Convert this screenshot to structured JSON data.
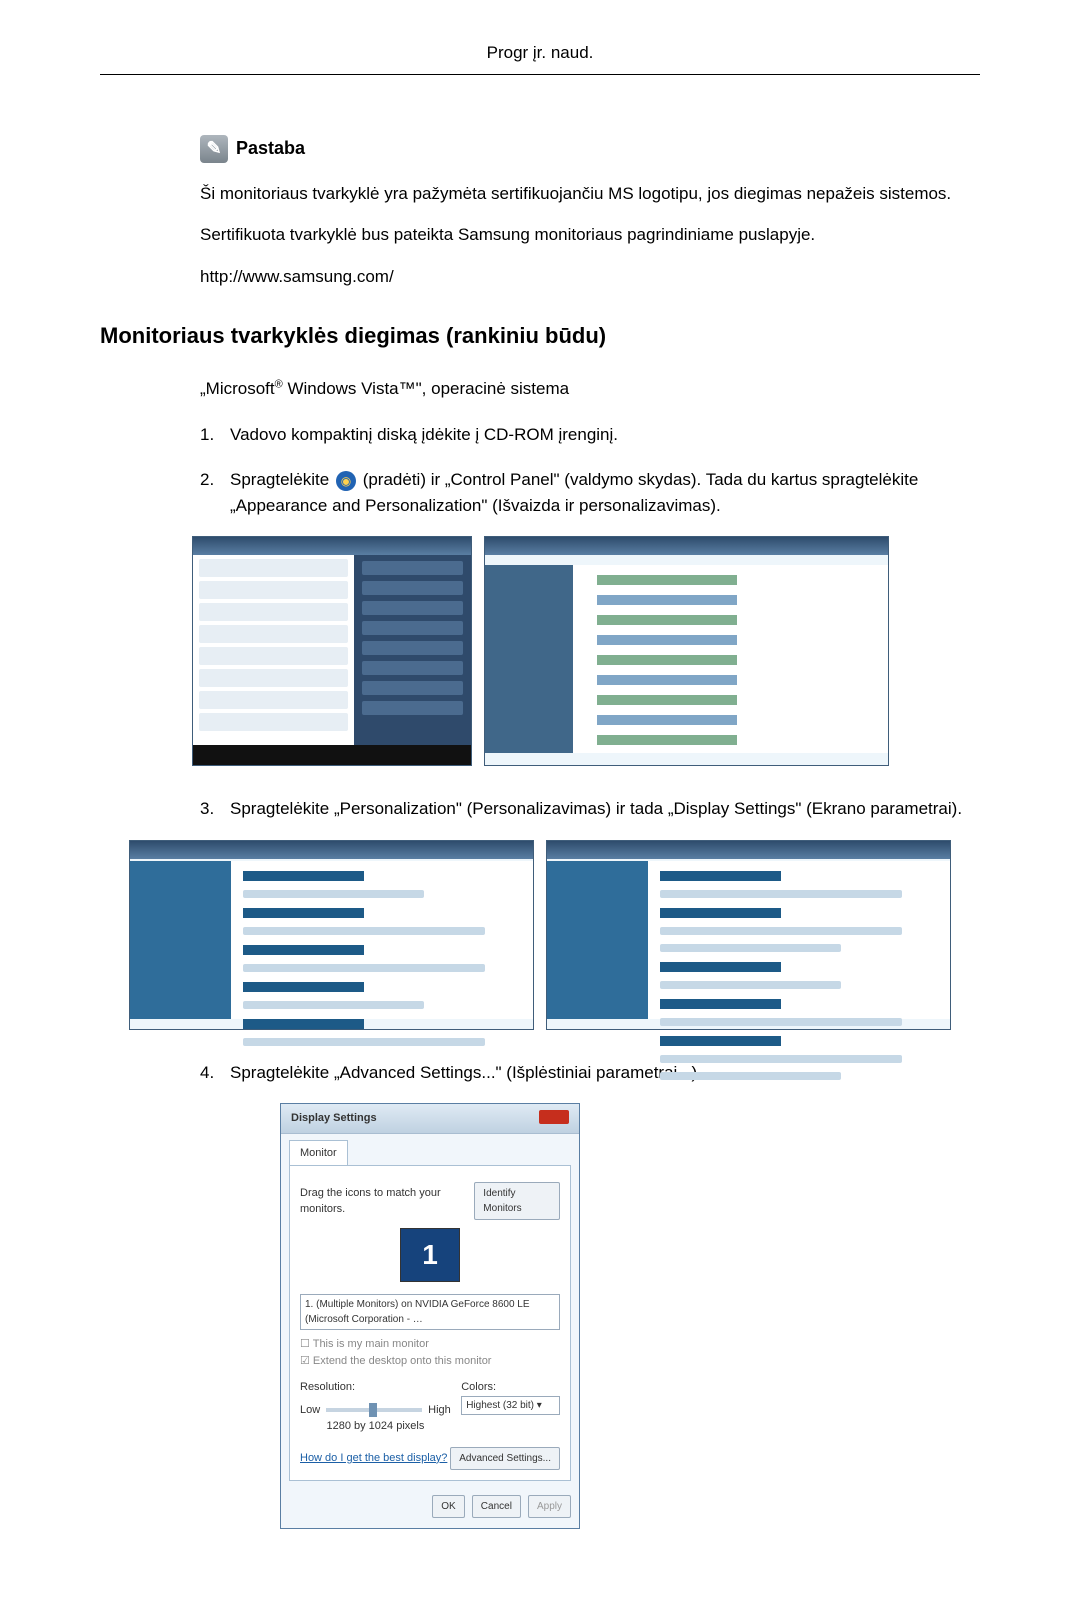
{
  "header": {
    "title": "Progr įr. naud."
  },
  "note": {
    "label": "Pastaba",
    "p1": "Ši monitoriaus tvarkyklė yra pažymėta sertifikuojančiu MS logotipu, jos diegimas nepažeis sistemos.",
    "p2": "Sertifikuota tvarkyklė bus pateikta Samsung monitoriaus pagrindiniame puslapyje.",
    "url": "http://www.samsung.com/"
  },
  "section": {
    "heading": "Monitoriaus tvarkyklės diegimas (rankiniu būdu)",
    "os_prefix": "„Microsoft",
    "os_reg": "®",
    "os_mid": " Windows Vista™\", operacinė sistema"
  },
  "steps": {
    "n1": "1.",
    "s1": "Vadovo kompaktinį diską įdėkite į CD-ROM įrenginį.",
    "n2": "2.",
    "s2a": "Spragtelėkite ",
    "s2b": "(pradėti) ir „Control Panel\" (valdymo skydas). Tada du kartus spragtelėkite „Appearance and Personalization\" (Išvaizda ir personalizavimas).",
    "n3": "3.",
    "s3": "Spragtelėkite „Personalization\" (Personalizavimas) ir tada „Display Settings\" (Ekrano parametrai).",
    "n4": "4.",
    "s4": "Spragtelėkite „Advanced Settings...\" (Išplėstiniai parametrai...)."
  },
  "display_dialog": {
    "title": "Display Settings",
    "tab": "Monitor",
    "drag_text": "Drag the icons to match your monitors.",
    "identify_btn": "Identify Monitors",
    "monitor_num": "1",
    "monitor_select": "1. (Multiple Monitors) on NVIDIA GeForce 8600 LE (Microsoft Corporation - …",
    "cb1": "This is my main monitor",
    "cb2": "Extend the desktop onto this monitor",
    "resolution_label": "Resolution:",
    "res_low": "Low",
    "res_high": "High",
    "res_value": "1280 by 1024 pixels",
    "colors_label": "Colors:",
    "colors_value": "Highest (32 bit)",
    "help_link": "How do I get the best display?",
    "advanced_btn": "Advanced Settings...",
    "ok": "OK",
    "cancel": "Cancel",
    "apply": "Apply"
  }
}
